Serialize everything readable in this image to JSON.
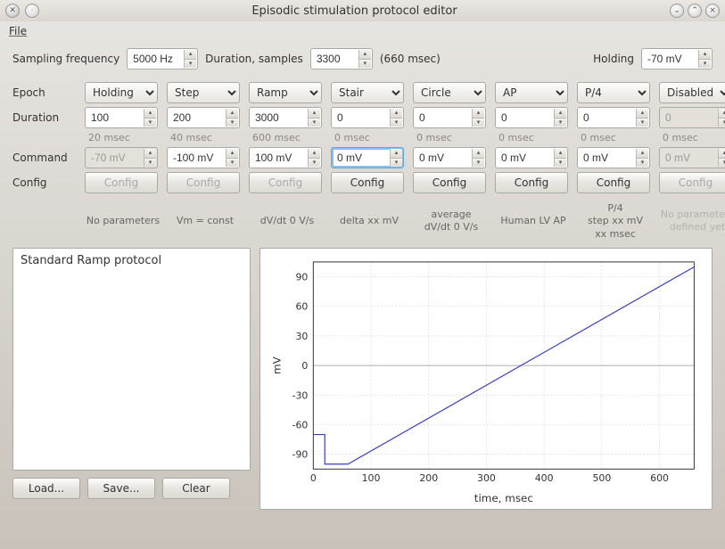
{
  "window": {
    "title": "Episodic stimulation protocol editor"
  },
  "menu": {
    "file": "File"
  },
  "topbar": {
    "sampling_label": "Sampling frequency",
    "sampling_value": "5000 Hz",
    "duration_label": "Duration, samples",
    "duration_value": "3300",
    "duration_hint": "(660 msec)",
    "holding_label": "Holding",
    "holding_value": "-70 mV"
  },
  "labels": {
    "epoch": "Epoch",
    "duration": "Duration",
    "command": "Command",
    "config": "Config"
  },
  "epochs": [
    "Holding",
    "Step",
    "Ramp",
    "Stair",
    "Circle",
    "AP",
    "P/4",
    "Disabled"
  ],
  "durations": [
    "100",
    "200",
    "3000",
    "0",
    "0",
    "0",
    "0",
    "0"
  ],
  "duration_msec": [
    "20 msec",
    "40 msec",
    "600 msec",
    "0 msec",
    "0 msec",
    "0 msec",
    "0 msec",
    "0 msec"
  ],
  "commands": [
    "-70 mV",
    "-100 mV",
    "100 mV",
    "0 mV",
    "0 mV",
    "0 mV",
    "0 mV",
    "0 mV"
  ],
  "command_disabled": [
    true,
    false,
    false,
    false,
    false,
    false,
    false,
    true
  ],
  "command_focused": [
    false,
    false,
    false,
    true,
    false,
    false,
    false,
    false
  ],
  "config_label": "Config",
  "config_disabled": [
    true,
    true,
    true,
    false,
    false,
    false,
    false,
    true
  ],
  "info": [
    "No parameters",
    "Vm = const",
    "dV/dt 0 V/s",
    "delta xx mV",
    "average\ndV/dt 0 V/s",
    "Human LV AP",
    "P/4\nstep xx mV\nxx msec",
    "No parameters\ndefined yet"
  ],
  "info_disabled": [
    false,
    false,
    false,
    false,
    false,
    false,
    false,
    true
  ],
  "protocol_list": {
    "item0": "Standard Ramp protocol"
  },
  "buttons": {
    "load": "Load...",
    "save": "Save...",
    "clear": "Clear"
  },
  "chart_data": {
    "type": "line",
    "xlabel": "time, msec",
    "ylabel": "mV",
    "xlim": [
      0,
      660
    ],
    "ylim": [
      -105,
      105
    ],
    "xticks": [
      0,
      100,
      200,
      300,
      400,
      500,
      600
    ],
    "yticks": [
      -90,
      -60,
      -30,
      0,
      30,
      60,
      90
    ],
    "series": [
      {
        "name": "protocol",
        "x": [
          0,
          20,
          20,
          60,
          660
        ],
        "y": [
          -70,
          -70,
          -100,
          -100,
          100
        ]
      }
    ]
  }
}
